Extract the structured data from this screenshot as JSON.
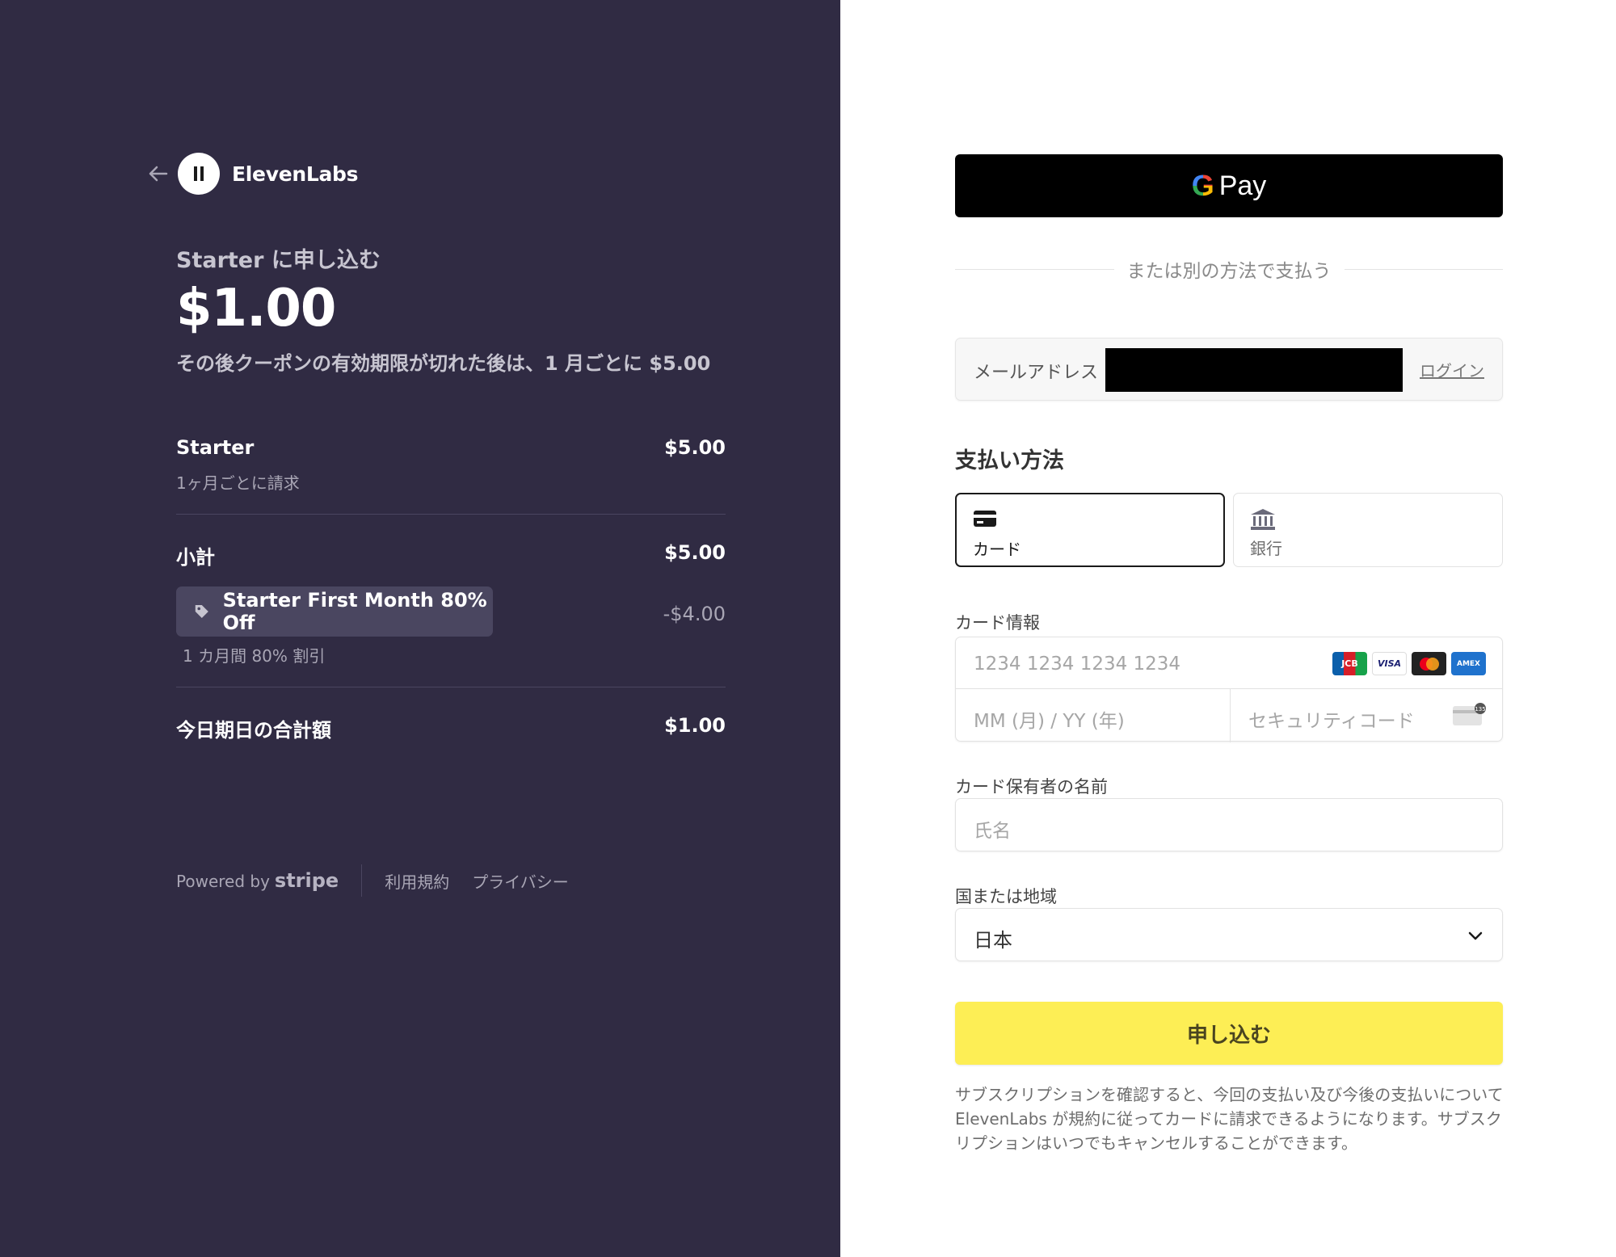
{
  "merchant": {
    "name": "ElevenLabs"
  },
  "summary": {
    "title": "Starter に申し込む",
    "price": "$1.00",
    "after_text": "その後クーポンの有効期限が切れた後は、1 月ごとに $5.00"
  },
  "line_items": {
    "plan_name": "Starter",
    "plan_billing": "1ヶ月ごとに請求",
    "plan_amount": "$5.00",
    "subtotal_label": "小計",
    "subtotal_amount": "$5.00",
    "coupon_label": "Starter First Month 80% Off",
    "coupon_amount": "-$4.00",
    "coupon_desc": "1 カ月間 80% 割引",
    "total_label": "今日期日の合計額",
    "total_amount": "$1.00"
  },
  "footer": {
    "powered_by": "Powered by",
    "stripe": "stripe",
    "terms": "利用規約",
    "privacy": "プライバシー"
  },
  "checkout": {
    "gpay_pay": "Pay",
    "or_text": "または別の方法で支払う",
    "email_label": "メールアドレス",
    "login": "ログイン",
    "payment_method_title": "支払い方法",
    "tab_card": "カード",
    "tab_bank": "銀行",
    "card_info_label": "カード情報",
    "card_number_placeholder": "1234 1234 1234 1234",
    "expiry_placeholder": "MM (月) / YY (年)",
    "cvc_placeholder": "セキュリティコード",
    "card_brands": [
      "JCB",
      "VISA",
      "Mastercard",
      "AMEX"
    ],
    "cardholder_label": "カード保有者の名前",
    "cardholder_placeholder": "氏名",
    "country_label": "国または地域",
    "country_value": "日本",
    "submit_label": "申し込む",
    "legal_text": "サブスクリプションを確認すると、今回の支払い及び今後の支払いについて ElevenLabs が規約に従ってカードに請求できるようになります。サブスクリプションはいつでもキャンセルすることができます。"
  },
  "colors": {
    "left_bg": "#302b43",
    "submit_bg": "#fdee55",
    "gpay_bg": "#000000"
  }
}
